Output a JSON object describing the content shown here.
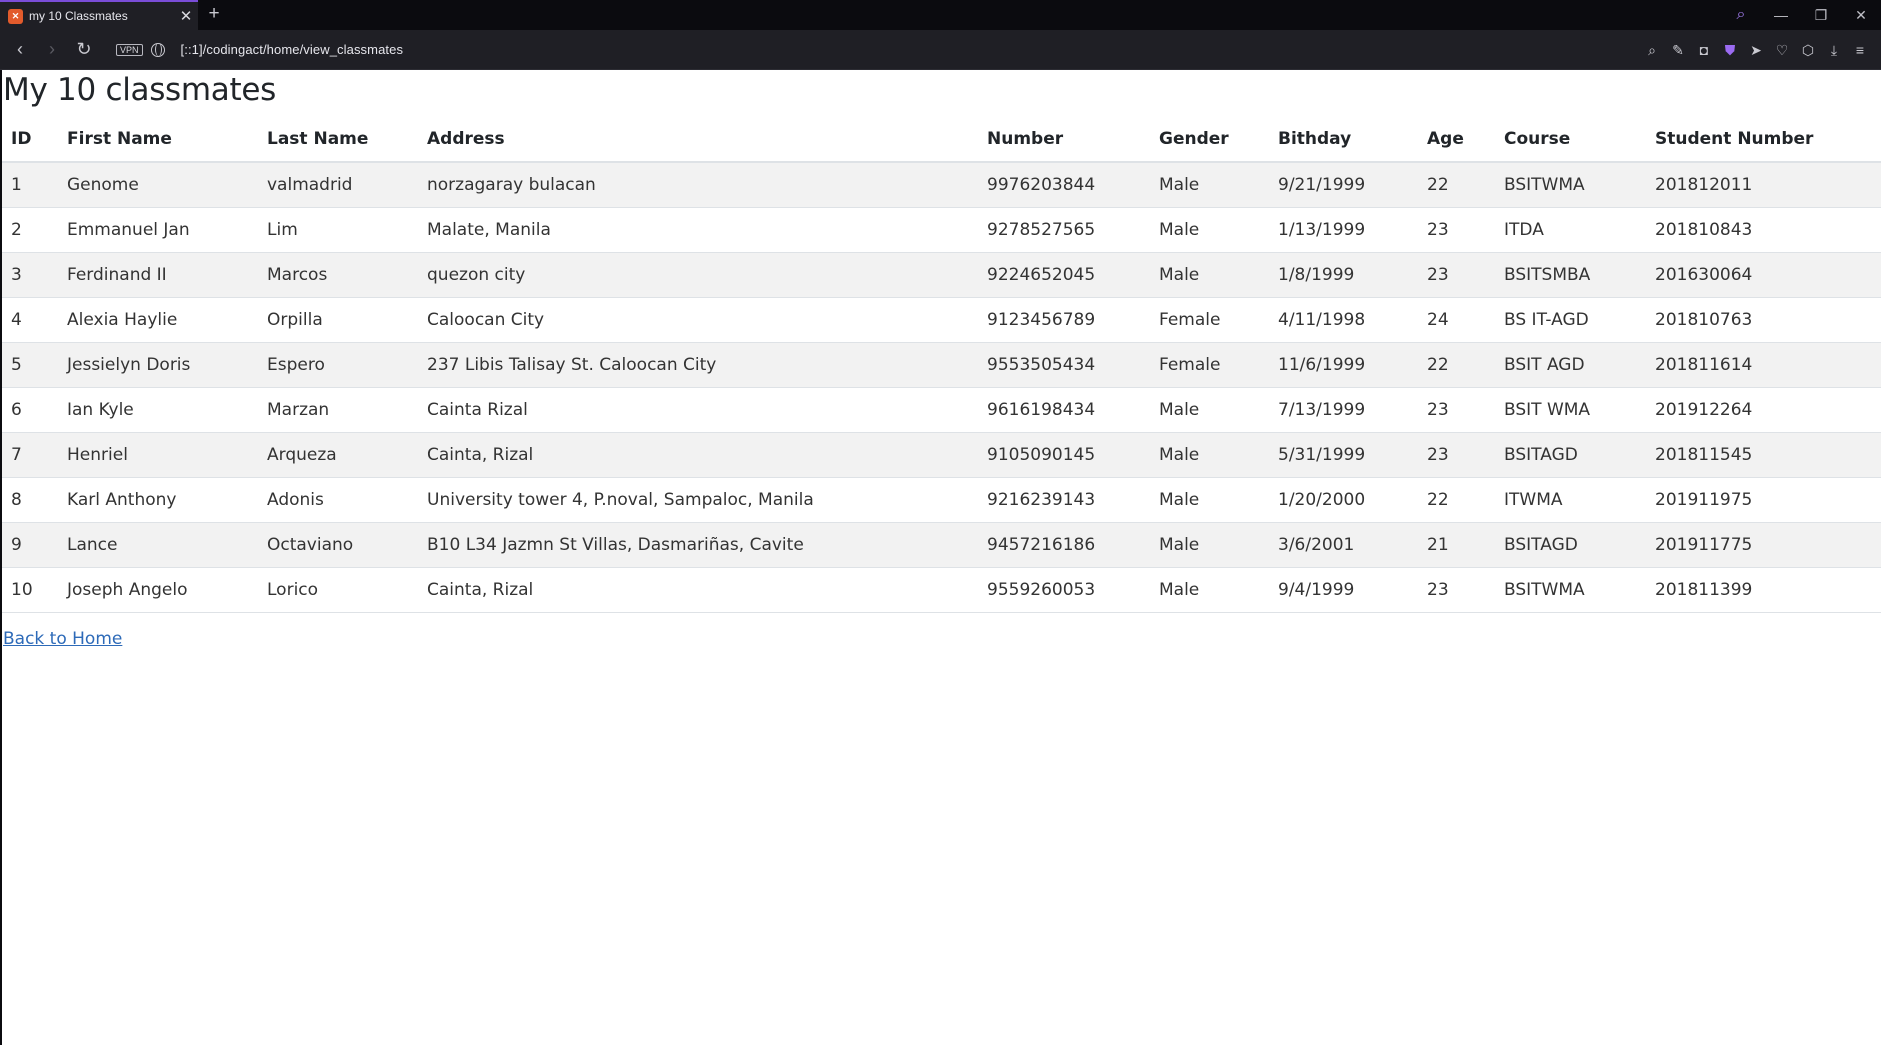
{
  "tab": {
    "title": "my 10 Classmates",
    "favicon": "xampp-icon"
  },
  "address": {
    "vpn": "VPN",
    "url": "[::1]/codingact/home/view_classmates"
  },
  "page": {
    "title": "My 10 classmates",
    "back_link": "Back to Home"
  },
  "table": {
    "headers": [
      "ID",
      "First Name",
      "Last Name",
      "Address",
      "Number",
      "Gender",
      "Bithday",
      "Age",
      "Course",
      "Student Number"
    ],
    "rows": [
      [
        "1",
        "Genome",
        "valmadrid",
        "norzagaray bulacan",
        "9976203844",
        "Male",
        "9/21/1999",
        "22",
        "BSITWMA",
        "201812011"
      ],
      [
        "2",
        "Emmanuel Jan",
        "Lim",
        "Malate, Manila",
        "9278527565",
        "Male",
        "1/13/1999",
        "23",
        "ITDA",
        "201810843"
      ],
      [
        "3",
        "Ferdinand II",
        "Marcos",
        "quezon city",
        "9224652045",
        "Male",
        "1/8/1999",
        "23",
        "BSITSMBA",
        "201630064"
      ],
      [
        "4",
        "Alexia Haylie",
        "Orpilla",
        "Caloocan City",
        "9123456789",
        "Female",
        "4/11/1998",
        "24",
        "BS IT-AGD",
        "201810763"
      ],
      [
        "5",
        "Jessielyn Doris",
        "Espero",
        "237 Libis Talisay St. Caloocan City",
        "9553505434",
        "Female",
        "11/6/1999",
        "22",
        "BSIT AGD",
        "201811614"
      ],
      [
        "6",
        "Ian Kyle",
        "Marzan",
        "Cainta Rizal",
        "9616198434",
        "Male",
        "7/13/1999",
        "23",
        "BSIT WMA",
        "201912264"
      ],
      [
        "7",
        "Henriel",
        "Arqueza",
        "Cainta, Rizal",
        "9105090145",
        "Male",
        "5/31/1999",
        "23",
        "BSITAGD",
        "201811545"
      ],
      [
        "8",
        "Karl Anthony",
        "Adonis",
        "University tower 4, P.noval, Sampaloc, Manila",
        "9216239143",
        "Male",
        "1/20/2000",
        "22",
        "ITWMA",
        "201911975"
      ],
      [
        "9",
        "Lance",
        "Octaviano",
        "B10 L34 Jazmn St Villas, Dasmariñas, Cavite",
        "9457216186",
        "Male",
        "3/6/2001",
        "21",
        "BSITAGD",
        "201911775"
      ],
      [
        "10",
        "Joseph Angelo",
        "Lorico",
        "Cainta, Rizal",
        "9559260053",
        "Male",
        "9/4/1999",
        "23",
        "BSITWMA",
        "201811399"
      ]
    ]
  },
  "colors": {
    "accent": "#7a4dd8",
    "link": "#2d6ab8",
    "stripe": "#f2f2f2"
  }
}
